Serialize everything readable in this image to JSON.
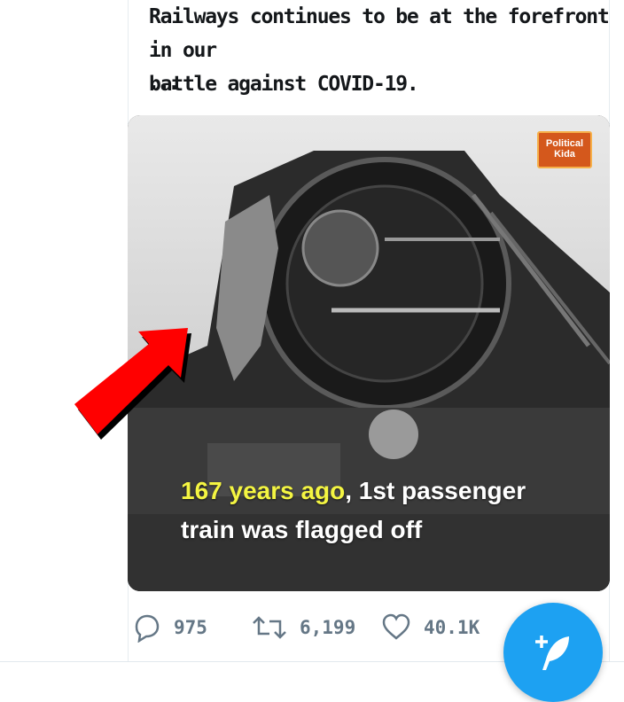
{
  "tweet": {
    "line1": "Railways continues to be at the forefront in our",
    "line2": "battle against COVID-19.",
    "more": "..."
  },
  "media": {
    "caption_highlight": "167 years ago",
    "caption_rest": ", 1st passenger",
    "caption_line2": "train was flagged off",
    "logo_line1": "Political",
    "logo_line2": "Kida"
  },
  "actions": {
    "reply_count": "975",
    "retweet_count": "6,199",
    "like_count": "40.1K"
  },
  "colors": {
    "accent": "#1da1f2",
    "caption_highlight": "#f4f542",
    "arrow": "#ff0000"
  }
}
